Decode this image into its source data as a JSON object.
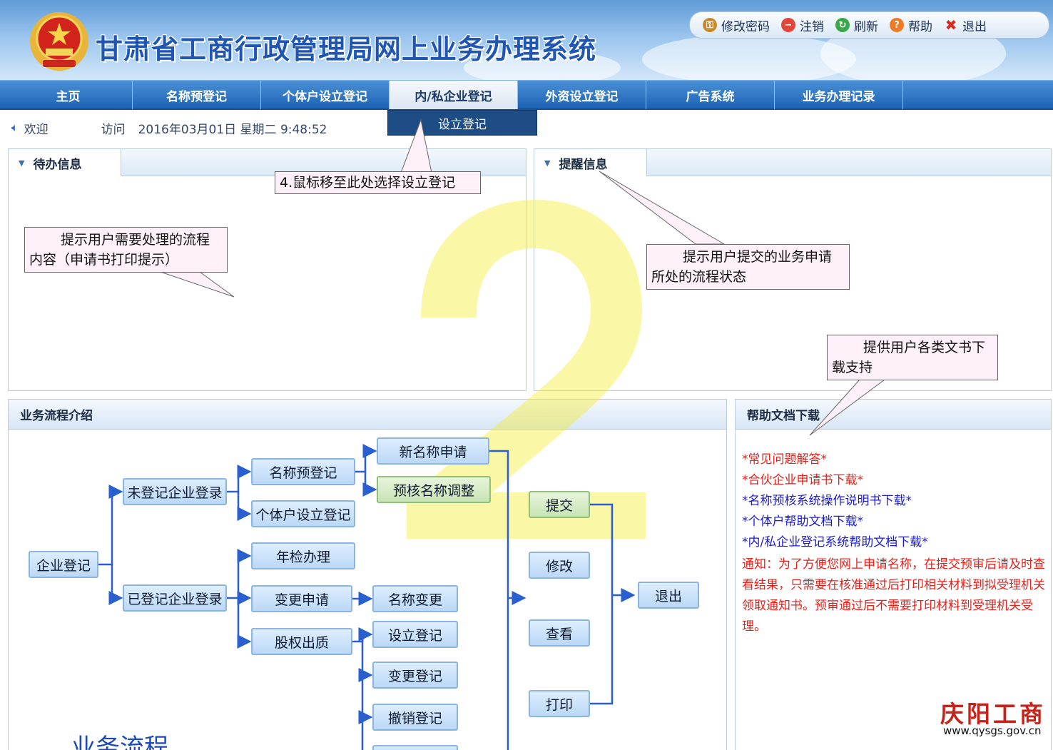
{
  "header": {
    "title": "甘肃省工商行政管理局网上业务办理系统"
  },
  "toolbar": {
    "items": [
      {
        "label": "修改密码",
        "icon": "user-key-icon"
      },
      {
        "label": "注销",
        "icon": "logout-icon"
      },
      {
        "label": "刷新",
        "icon": "refresh-icon"
      },
      {
        "label": "帮助",
        "icon": "help-icon"
      },
      {
        "label": "退出",
        "icon": "close-icon"
      }
    ]
  },
  "nav": {
    "items": [
      "主页",
      "名称预登记",
      "个体户设立登记",
      "内/私企业登记",
      "外资设立登记",
      "广告系统",
      "业务办理记录"
    ],
    "active_index": 3,
    "dropdown_item": "设立登记"
  },
  "status": {
    "welcome": "欢迎",
    "visit": "访问",
    "datetime": "2016年03月01日 星期二 9:48:52"
  },
  "panels": {
    "todo": {
      "title": "待办信息"
    },
    "reminder": {
      "title": "提醒信息"
    },
    "process": {
      "title": "业务流程介绍",
      "big_label": "业务流程"
    },
    "help": {
      "title": "帮助文档下载"
    }
  },
  "callouts": {
    "step4": "4.鼠标移至此处选择设立登记",
    "todo_hint": "提示用户需要处理的流程内容（申请书打印提示）",
    "reminder_hint": "提示用户提交的业务申请所处的流程状态",
    "help_hint": "提供用户各类文书下载支持"
  },
  "help_links": [
    {
      "text": "*常见问题解答*",
      "color": "#e8201a"
    },
    {
      "text": "*合伙企业申请书下载*",
      "color": "#e8201a"
    },
    {
      "text": "*名称预核系统操作说明书下载*",
      "color": "#1a1ad6"
    },
    {
      "text": "*个体户帮助文档下载*",
      "color": "#1a1ad6"
    },
    {
      "text": "*内/私企业登记系统帮助文档下载*",
      "color": "#1a1ad6"
    }
  ],
  "notice": "通知：为了方便您网上申请名称，在提交预审后请及时查看结果，只需要在核准通过后打印相关材料到拟受理机关领取通知书。预审通过后不需要打印材料到受理机关受理。",
  "flow": {
    "root": "企业登记",
    "unregistered": "未登记企业登录",
    "name_prereg": "名称预登记",
    "new_name": "新名称申请",
    "adjust_name": "预核名称调整",
    "individual": "个体户设立登记",
    "registered": "已登记企业登录",
    "annual": "年检办理",
    "change_apply": "变更申请",
    "name_change": "名称变更",
    "equity": "股权出质",
    "setup_reg": "设立登记",
    "change_reg": "变更登记",
    "cancel_reg": "撤销登记",
    "submit": "提交",
    "modify": "修改",
    "view": "查看",
    "print": "打印",
    "exit": "退出"
  },
  "overlay": {
    "big_number": "2",
    "color": "#f3ec2e"
  },
  "watermark": {
    "logo_text": "庆阳工商",
    "url": "www.qysgs.gov.cn"
  },
  "colors": {
    "nav_blue": "#1d63b5",
    "flow_line": "#2a5fd0",
    "callout_bg": "#fdf0f8",
    "notice_red": "#e8201a"
  }
}
